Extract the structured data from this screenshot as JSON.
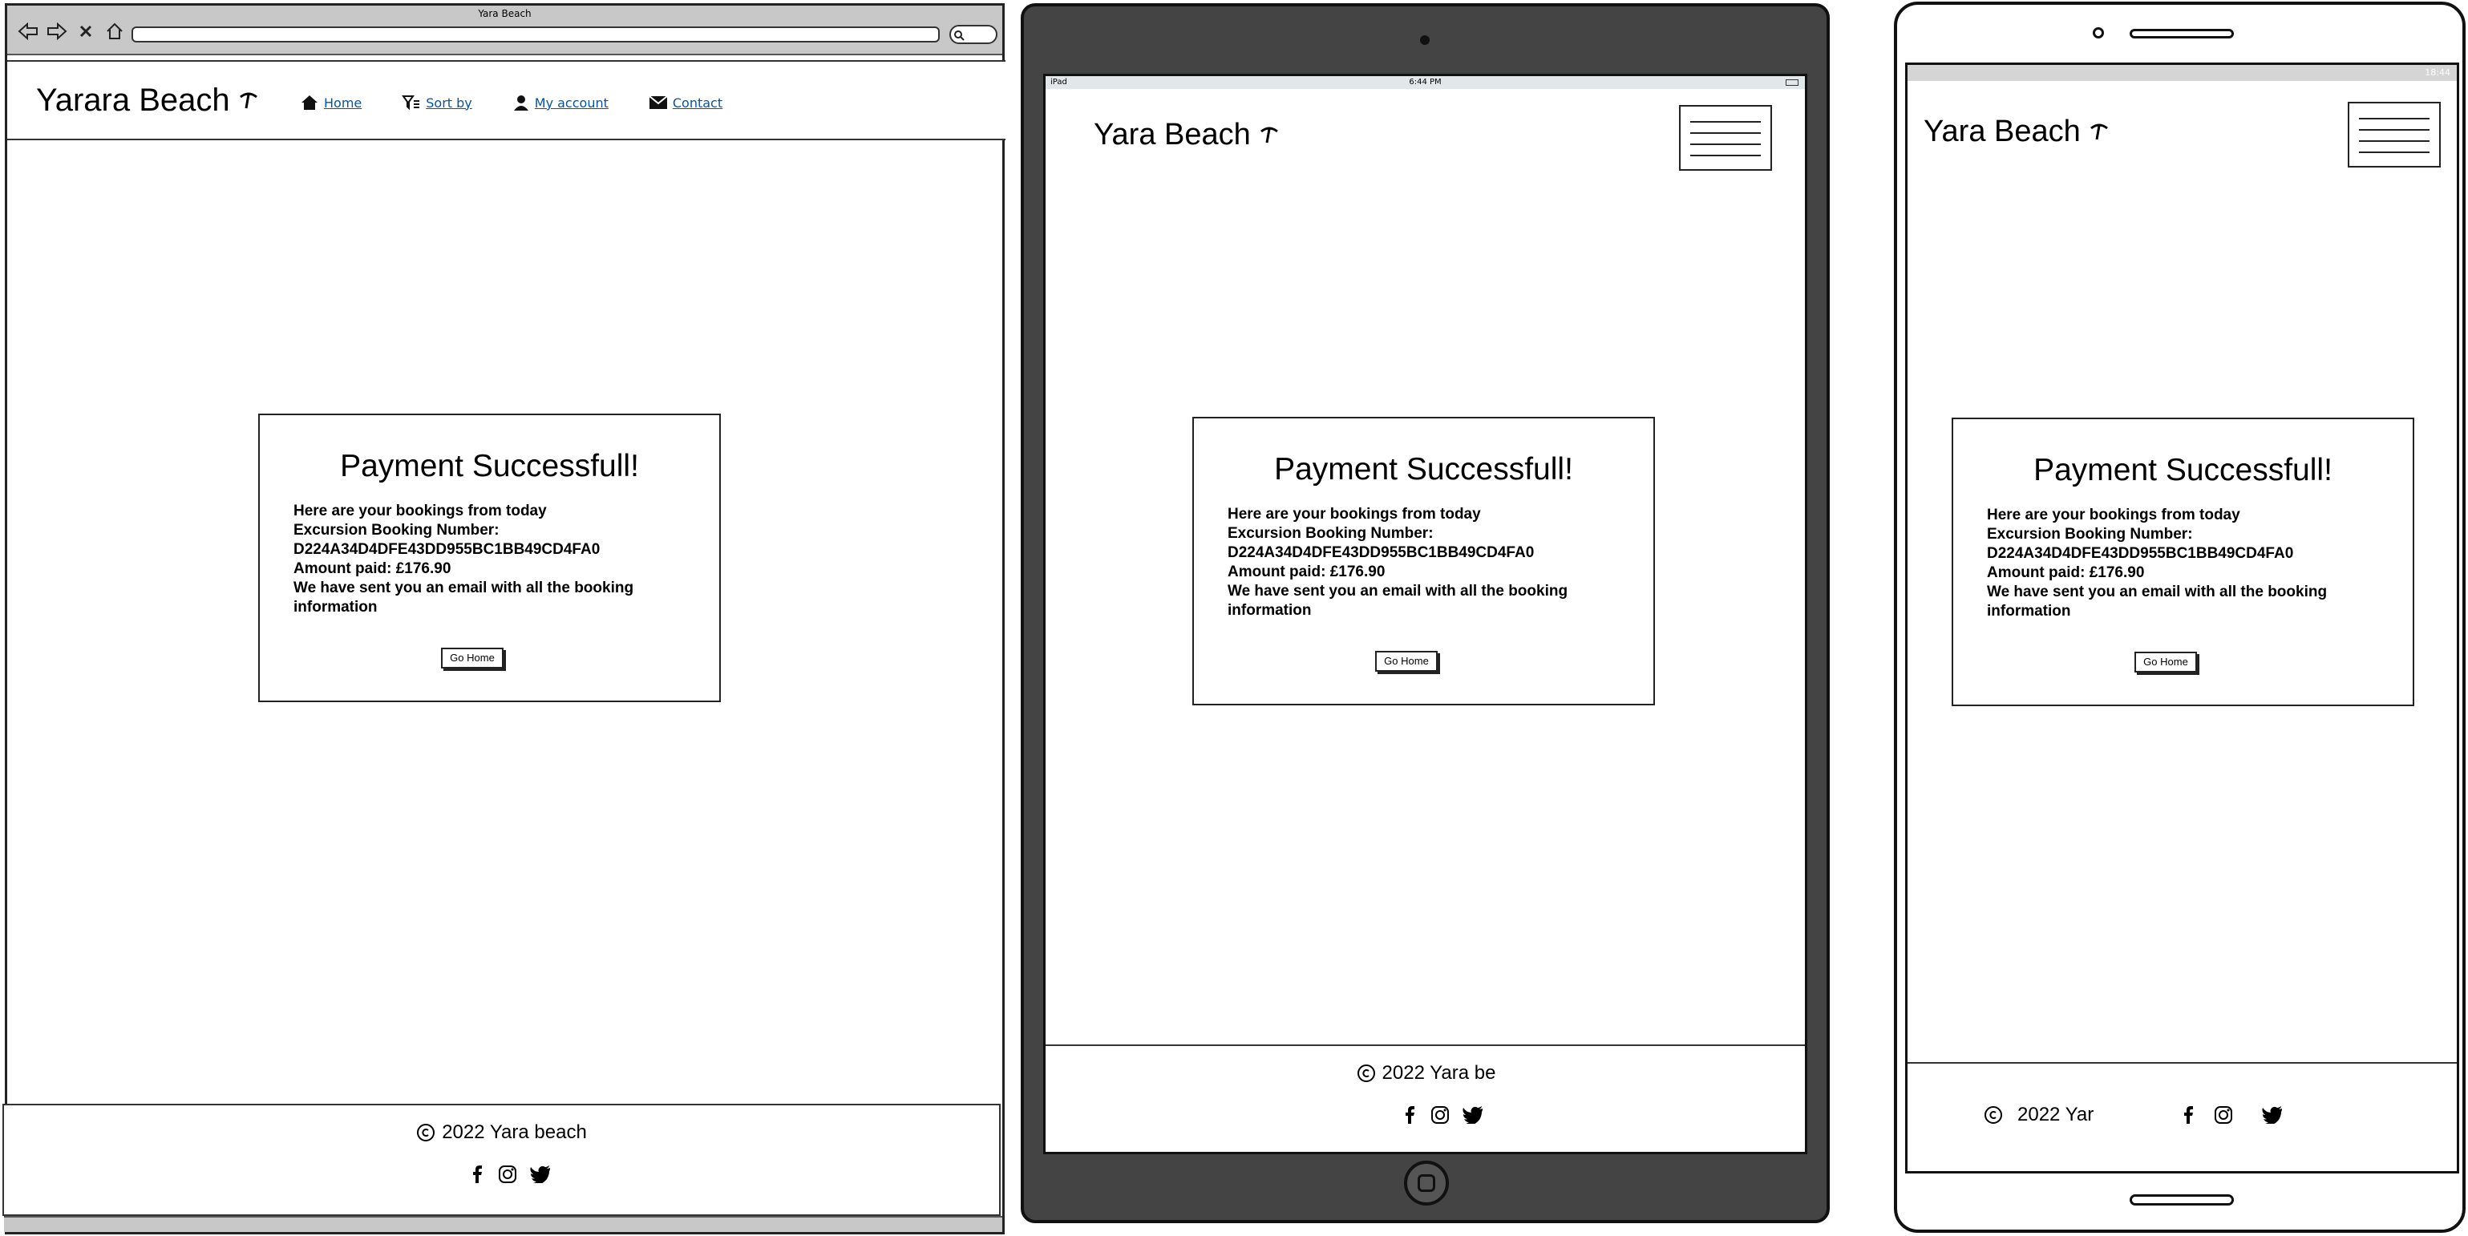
{
  "browser": {
    "window_title": "Yara Beach",
    "logo_text": "Yarara Beach",
    "nav": [
      {
        "label": "Home",
        "icon": "home-icon"
      },
      {
        "label": "Sort by",
        "icon": "filter-icon"
      },
      {
        "label": "My account",
        "icon": "user-icon"
      },
      {
        "label": "Contact",
        "icon": "envelope-icon"
      }
    ],
    "footer_text": "2022 Yara beach"
  },
  "tablet": {
    "status_left": "iPad",
    "status_time": "6:44 PM",
    "logo_text": "Yara Beach",
    "footer_text": "2022 Yara be"
  },
  "phone": {
    "status_time": "18:44",
    "logo_text": "Yara Beach",
    "footer_text": "2022 Yar"
  },
  "card": {
    "title": "Payment Successfull!",
    "line1": "Here are your bookings from today",
    "line2": "Excursion Booking Number:",
    "line3": "D224A34D4DFE43DD955BC1BB49CD4FA0",
    "line4": "Amount paid: £176.90",
    "line5": "We have sent you an email with all the booking information",
    "button": "Go Home"
  },
  "icons": {
    "logo": "palm-tree-icon",
    "copyright": "copyright-icon",
    "social": [
      "facebook-icon",
      "instagram-icon",
      "twitter-icon"
    ]
  }
}
